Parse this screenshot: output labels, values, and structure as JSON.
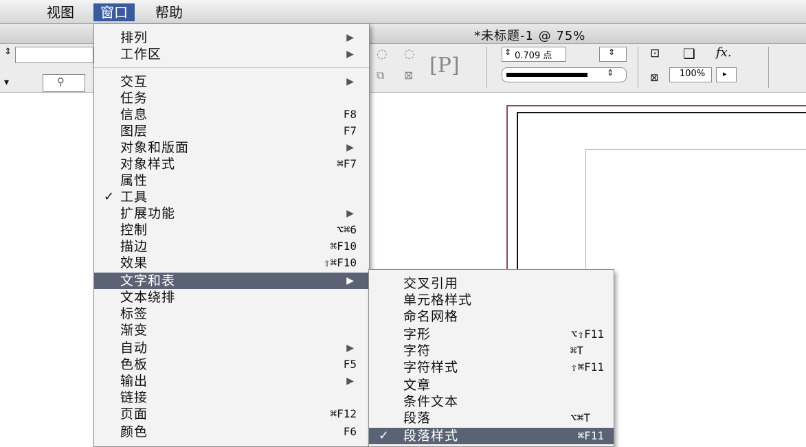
{
  "menubar": {
    "items": [
      {
        "label": "视图"
      },
      {
        "label": "窗口",
        "active": true
      },
      {
        "label": "帮助"
      }
    ]
  },
  "document": {
    "title": "*未标题-1 @ 75%"
  },
  "control": {
    "stroke_weight": "0.709 点",
    "opacity": "100%",
    "fx": "fx."
  },
  "window_menu": {
    "items": [
      {
        "label": "排列",
        "submenu": true
      },
      {
        "label": "工作区",
        "submenu": true
      },
      {
        "label": "交互",
        "submenu": true
      },
      {
        "label": "任务"
      },
      {
        "label": "信息",
        "shortcut": "F8"
      },
      {
        "label": "图层",
        "shortcut": "F7"
      },
      {
        "label": "对象和版面",
        "submenu": true
      },
      {
        "label": "对象样式",
        "shortcut": "⌘F7"
      },
      {
        "label": "属性"
      },
      {
        "label": "工具",
        "checked": true
      },
      {
        "label": "扩展功能",
        "submenu": true
      },
      {
        "label": "控制",
        "shortcut": "⌥⌘6"
      },
      {
        "label": "描边",
        "shortcut": "⌘F10"
      },
      {
        "label": "效果",
        "shortcut": "⇧⌘F10"
      },
      {
        "label": "文字和表",
        "submenu": true,
        "highlighted": true
      },
      {
        "label": "文本绕排"
      },
      {
        "label": "标签"
      },
      {
        "label": "渐变"
      },
      {
        "label": "自动",
        "submenu": true
      },
      {
        "label": "色板",
        "shortcut": "F5"
      },
      {
        "label": "输出",
        "submenu": true
      },
      {
        "label": "链接"
      },
      {
        "label": "页面",
        "shortcut": "⌘F12"
      },
      {
        "label": "颜色",
        "shortcut": "F6"
      }
    ]
  },
  "type_submenu": {
    "items": [
      {
        "label": "交叉引用"
      },
      {
        "label": "单元格样式"
      },
      {
        "label": "命名网格"
      },
      {
        "label": "字形",
        "shortcut": "⌥⇧F11"
      },
      {
        "label": "字符",
        "shortcut": "⌘T"
      },
      {
        "label": "字符样式",
        "shortcut": "⇧⌘F11"
      },
      {
        "label": "文章"
      },
      {
        "label": "条件文本"
      },
      {
        "label": "段落",
        "shortcut": "⌥⌘T"
      },
      {
        "label": "段落样式",
        "shortcut": "⌘F11",
        "checked": true,
        "highlighted": true
      }
    ]
  }
}
